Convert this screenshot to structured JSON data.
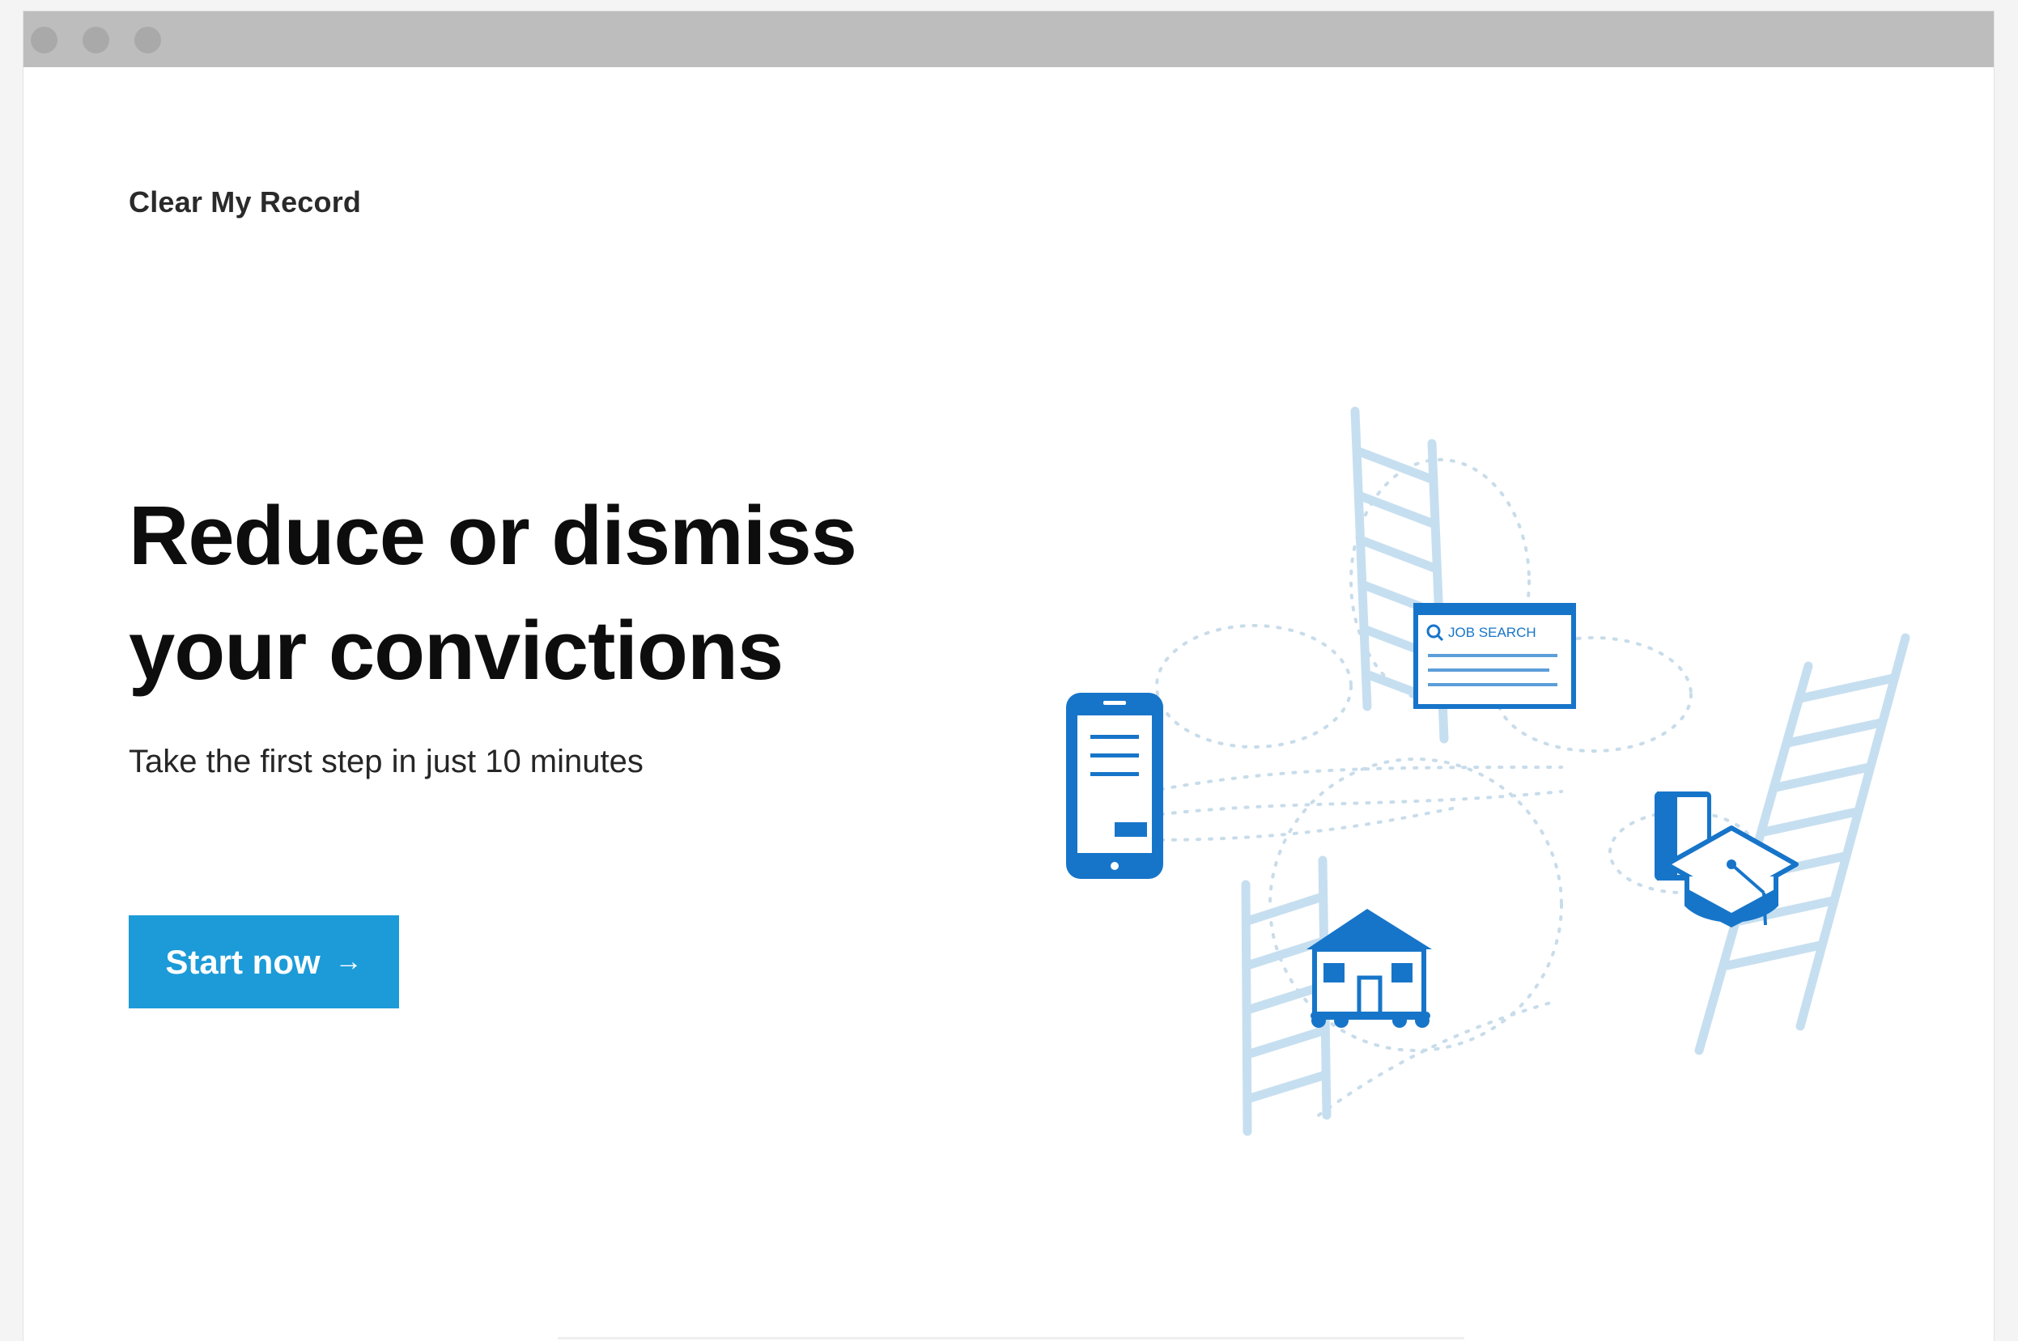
{
  "window": {
    "controls": [
      "close",
      "minimize",
      "maximize"
    ]
  },
  "header": {
    "brand": "Clear My Record"
  },
  "hero": {
    "headline": "Reduce or dismiss your convictions",
    "subtitle": "Take the first step in just 10 minutes",
    "cta_label": "Start now",
    "cta_arrow": "→"
  },
  "illustration": {
    "job_search_label": "JOB SEARCH",
    "icons": [
      "phone-icon",
      "job-search-window-icon",
      "house-icon",
      "graduation-cap-icon",
      "book-icon",
      "ladder-icon"
    ]
  },
  "colors": {
    "accent": "#1c9bd8",
    "illustration_blue": "#1775c9",
    "ladder_blue": "#c6dff0",
    "titlebar": "#bdbdbd"
  }
}
